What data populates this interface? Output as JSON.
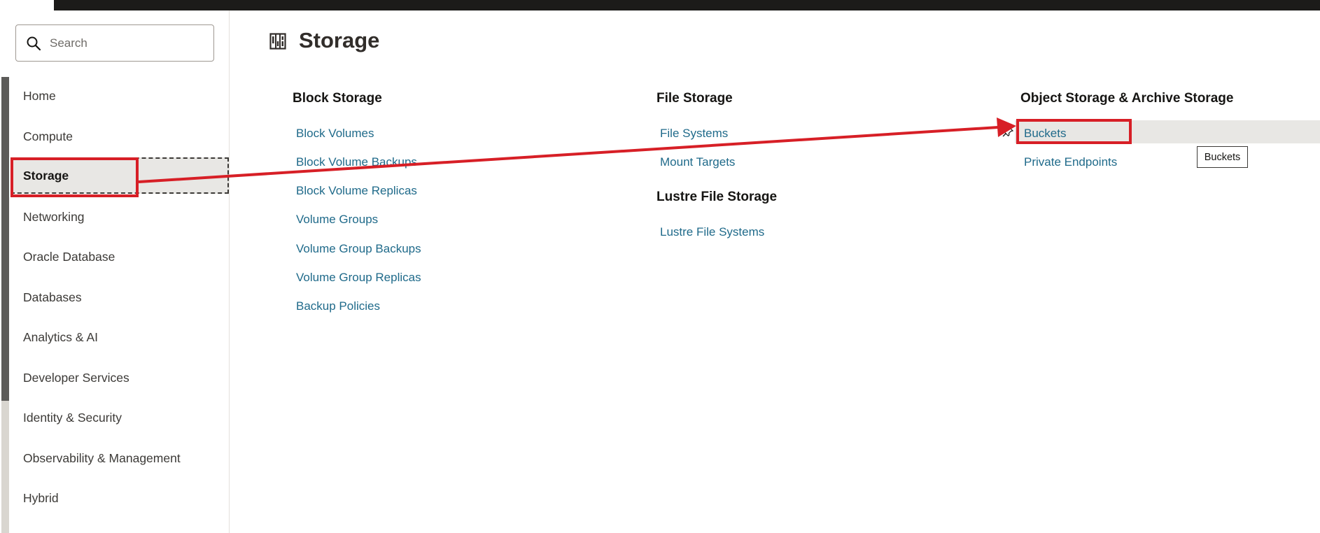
{
  "search": {
    "placeholder": "Search"
  },
  "sidebar": {
    "items": [
      {
        "label": "Home"
      },
      {
        "label": "Compute"
      },
      {
        "label": "Storage"
      },
      {
        "label": "Networking"
      },
      {
        "label": "Oracle Database"
      },
      {
        "label": "Databases"
      },
      {
        "label": "Analytics & AI"
      },
      {
        "label": "Developer Services"
      },
      {
        "label": "Identity & Security"
      },
      {
        "label": "Observability & Management"
      },
      {
        "label": "Hybrid"
      }
    ],
    "selected_index": 2
  },
  "main": {
    "title": "Storage",
    "title_icon": "storage-grid-icon",
    "sections": [
      {
        "heading": "Block Storage",
        "links": [
          "Block Volumes",
          "Block Volume Backups",
          "Block Volume Replicas",
          "Volume Groups",
          "Volume Group Backups",
          "Volume Group Replicas",
          "Backup Policies"
        ]
      },
      {
        "heading": "File Storage",
        "links": [
          "File Systems",
          "Mount Targets"
        ]
      },
      {
        "heading": "Lustre File Storage",
        "links": [
          "Lustre File Systems"
        ]
      },
      {
        "heading": "Object Storage & Archive Storage",
        "links": [
          "Buckets",
          "Private Endpoints"
        ]
      }
    ]
  },
  "tooltip": {
    "text": "Buckets"
  },
  "colors": {
    "accent_link": "#1f6a8a",
    "annotation_red": "#d71f26",
    "topbar": "#1c1b19"
  }
}
